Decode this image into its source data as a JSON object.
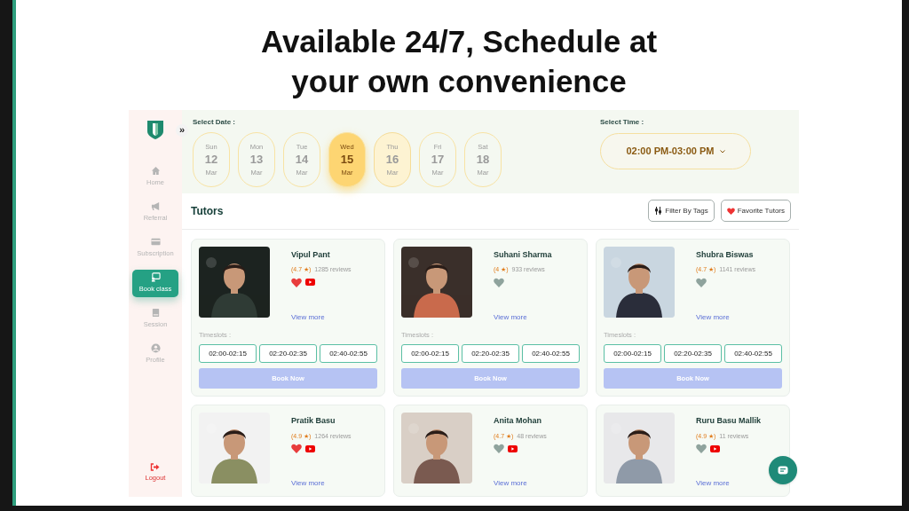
{
  "headline": "Available 24/7, Schedule at your own convenience",
  "sidebar": {
    "expand_toggle": "»",
    "items": [
      {
        "kind": "home",
        "label": "Home",
        "selected": false
      },
      {
        "kind": "referral",
        "label": "Referral",
        "selected": false
      },
      {
        "kind": "subscription",
        "label": "Subscription",
        "selected": false
      },
      {
        "kind": "book",
        "label": "Book class",
        "selected": true
      },
      {
        "kind": "session",
        "label": "Session",
        "selected": false
      },
      {
        "kind": "profile",
        "label": "Profile",
        "selected": false
      }
    ],
    "logout": "Logout"
  },
  "date_picker": {
    "label": "Select Date :",
    "dates": [
      {
        "weekday": "Sun",
        "day": "12",
        "month": "Mar",
        "selected": false,
        "highlighted": false
      },
      {
        "weekday": "Mon",
        "day": "13",
        "month": "Mar",
        "selected": false,
        "highlighted": false
      },
      {
        "weekday": "Tue",
        "day": "14",
        "month": "Mar",
        "selected": false,
        "highlighted": false
      },
      {
        "weekday": "Wed",
        "day": "15",
        "month": "Mar",
        "selected": true,
        "highlighted": false
      },
      {
        "weekday": "Thu",
        "day": "16",
        "month": "Mar",
        "selected": false,
        "highlighted": true
      },
      {
        "weekday": "Fri",
        "day": "17",
        "month": "Mar",
        "selected": false,
        "highlighted": false
      },
      {
        "weekday": "Sat",
        "day": "18",
        "month": "Mar",
        "selected": false,
        "highlighted": false
      }
    ]
  },
  "time_picker": {
    "label": "Select Time :",
    "value": "02:00 PM-03:00 PM"
  },
  "tutors_header": {
    "title": "Tutors",
    "buttons": [
      "Filter By Tags",
      "Favorite Tutors"
    ]
  },
  "tutors": [
    {
      "name": "Vipul Pant",
      "rating": "(4.7 ★)",
      "reviews": "1285 reviews",
      "favorite": true,
      "youtube": true,
      "link": "View more",
      "timeslots_label": "Timeslots :",
      "timeslots": [
        "02:00-02:15",
        "02:20-02:35",
        "02:40-02:55"
      ],
      "action": "Book Now"
    },
    {
      "name": "Suhani Sharma",
      "rating": "(4 ★)",
      "reviews": "933 reviews",
      "favorite": false,
      "youtube": false,
      "link": "View more",
      "timeslots_label": "Timeslots :",
      "timeslots": [
        "02:00-02:15",
        "02:20-02:35",
        "02:40-02:55"
      ],
      "action": "Book Now"
    },
    {
      "name": "Shubra Biswas",
      "rating": "(4.7 ★)",
      "reviews": "1141 reviews",
      "favorite": false,
      "youtube": false,
      "link": "View more",
      "timeslots_label": "Timeslots :",
      "timeslots": [
        "02:00-02:15",
        "02:20-02:35",
        "02:40-02:55"
      ],
      "action": "Book Now"
    },
    {
      "name": "Pratik Basu",
      "rating": "(4.9 ★)",
      "reviews": "1264 reviews",
      "favorite": true,
      "youtube": true,
      "link": "View more"
    },
    {
      "name": "Anita Mohan",
      "rating": "(4.7 ★)",
      "reviews": "48 reviews",
      "favorite": false,
      "youtube": true,
      "link": "View more"
    },
    {
      "name": "Ruru Basu Mallik",
      "rating": "(4.9 ★)",
      "reviews": "11 reviews",
      "favorite": false,
      "youtube": true,
      "link": "View more"
    }
  ]
}
